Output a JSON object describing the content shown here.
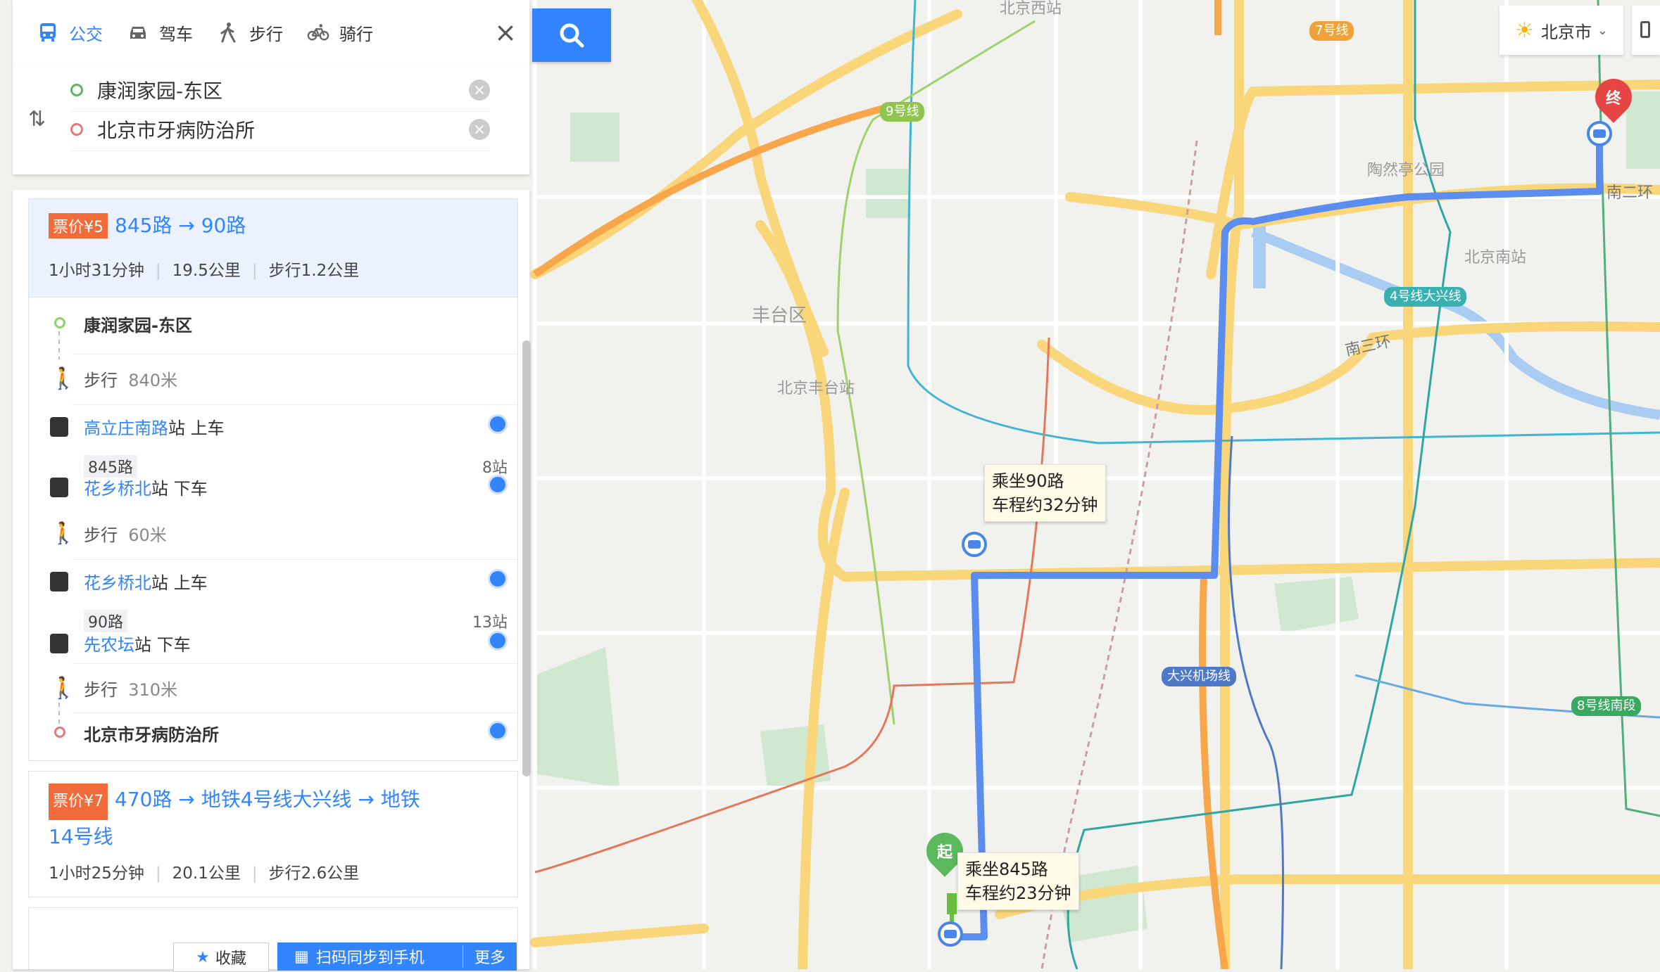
{
  "modes": [
    {
      "label": "公交",
      "icon": "bus-icon",
      "active": true
    },
    {
      "label": "驾车",
      "icon": "car-icon",
      "active": false
    },
    {
      "label": "步行",
      "icon": "walk-icon",
      "active": false
    },
    {
      "label": "骑行",
      "icon": "bike-icon",
      "active": false
    }
  ],
  "route": {
    "from": "康润家园-东区",
    "to": "北京市牙病防治所"
  },
  "plans": [
    {
      "fare": "票价¥5",
      "title": "845路 → 90路",
      "duration": "1小时31分钟",
      "distance": "19.5公里",
      "walk": "步行1.2公里",
      "steps": {
        "start": "康润家园-东区",
        "walk1": "步行",
        "walk1_dist": "840米",
        "board1_station": "高立庄南路",
        "board1_suffix": "站  上车",
        "line1": "845路",
        "line1_stops": "8站",
        "alight1_station": "花乡桥北",
        "alight1_suffix": "站  下车",
        "walk2": "步行",
        "walk2_dist": "60米",
        "board2_station": "花乡桥北",
        "board2_suffix": "站  上车",
        "line2": "90路",
        "line2_stops": "13站",
        "alight2_station": "先农坛",
        "alight2_suffix": "站  下车",
        "walk3": "步行",
        "walk3_dist": "310米",
        "end": "北京市牙病防治所"
      }
    },
    {
      "fare": "票价¥7",
      "title_line1": "470路 → 地铁4号线大兴线 → 地铁",
      "title_line2": "14号线",
      "duration": "1小时25分钟",
      "distance": "20.1公里",
      "walk": "步行2.6公里"
    }
  ],
  "bottom": {
    "favorite": "收藏",
    "sync": "扫码同步到手机",
    "more": "更多"
  },
  "city": "北京市",
  "map": {
    "labels": {
      "beijing_west": "北京西站",
      "fengtai_district": "丰台区",
      "fengtai_station": "北京丰台站",
      "taoranting": "陶然亭公园",
      "beijing_south": "北京南站",
      "south_3rd_ring": "南三环",
      "south_2nd_ring": "南二环"
    },
    "lines": {
      "line7": "7号线",
      "line9": "9号线",
      "line4": "4号线大兴线",
      "daxing_airport": "大兴机场线",
      "line8": "8号线南段"
    },
    "pins": {
      "start": "起",
      "end": "终"
    },
    "tips": {
      "ride1_a": "乘坐845路",
      "ride1_b": "车程约23分钟",
      "ride2_a": "乘坐90路",
      "ride2_b": "车程约32分钟"
    }
  },
  "colors": {
    "accent": "#3385ff",
    "fare": "#f26b3a",
    "route": "#5b8def",
    "road": "#f9d67a",
    "start_pin": "#5cb85c",
    "end_pin": "#e64545"
  }
}
